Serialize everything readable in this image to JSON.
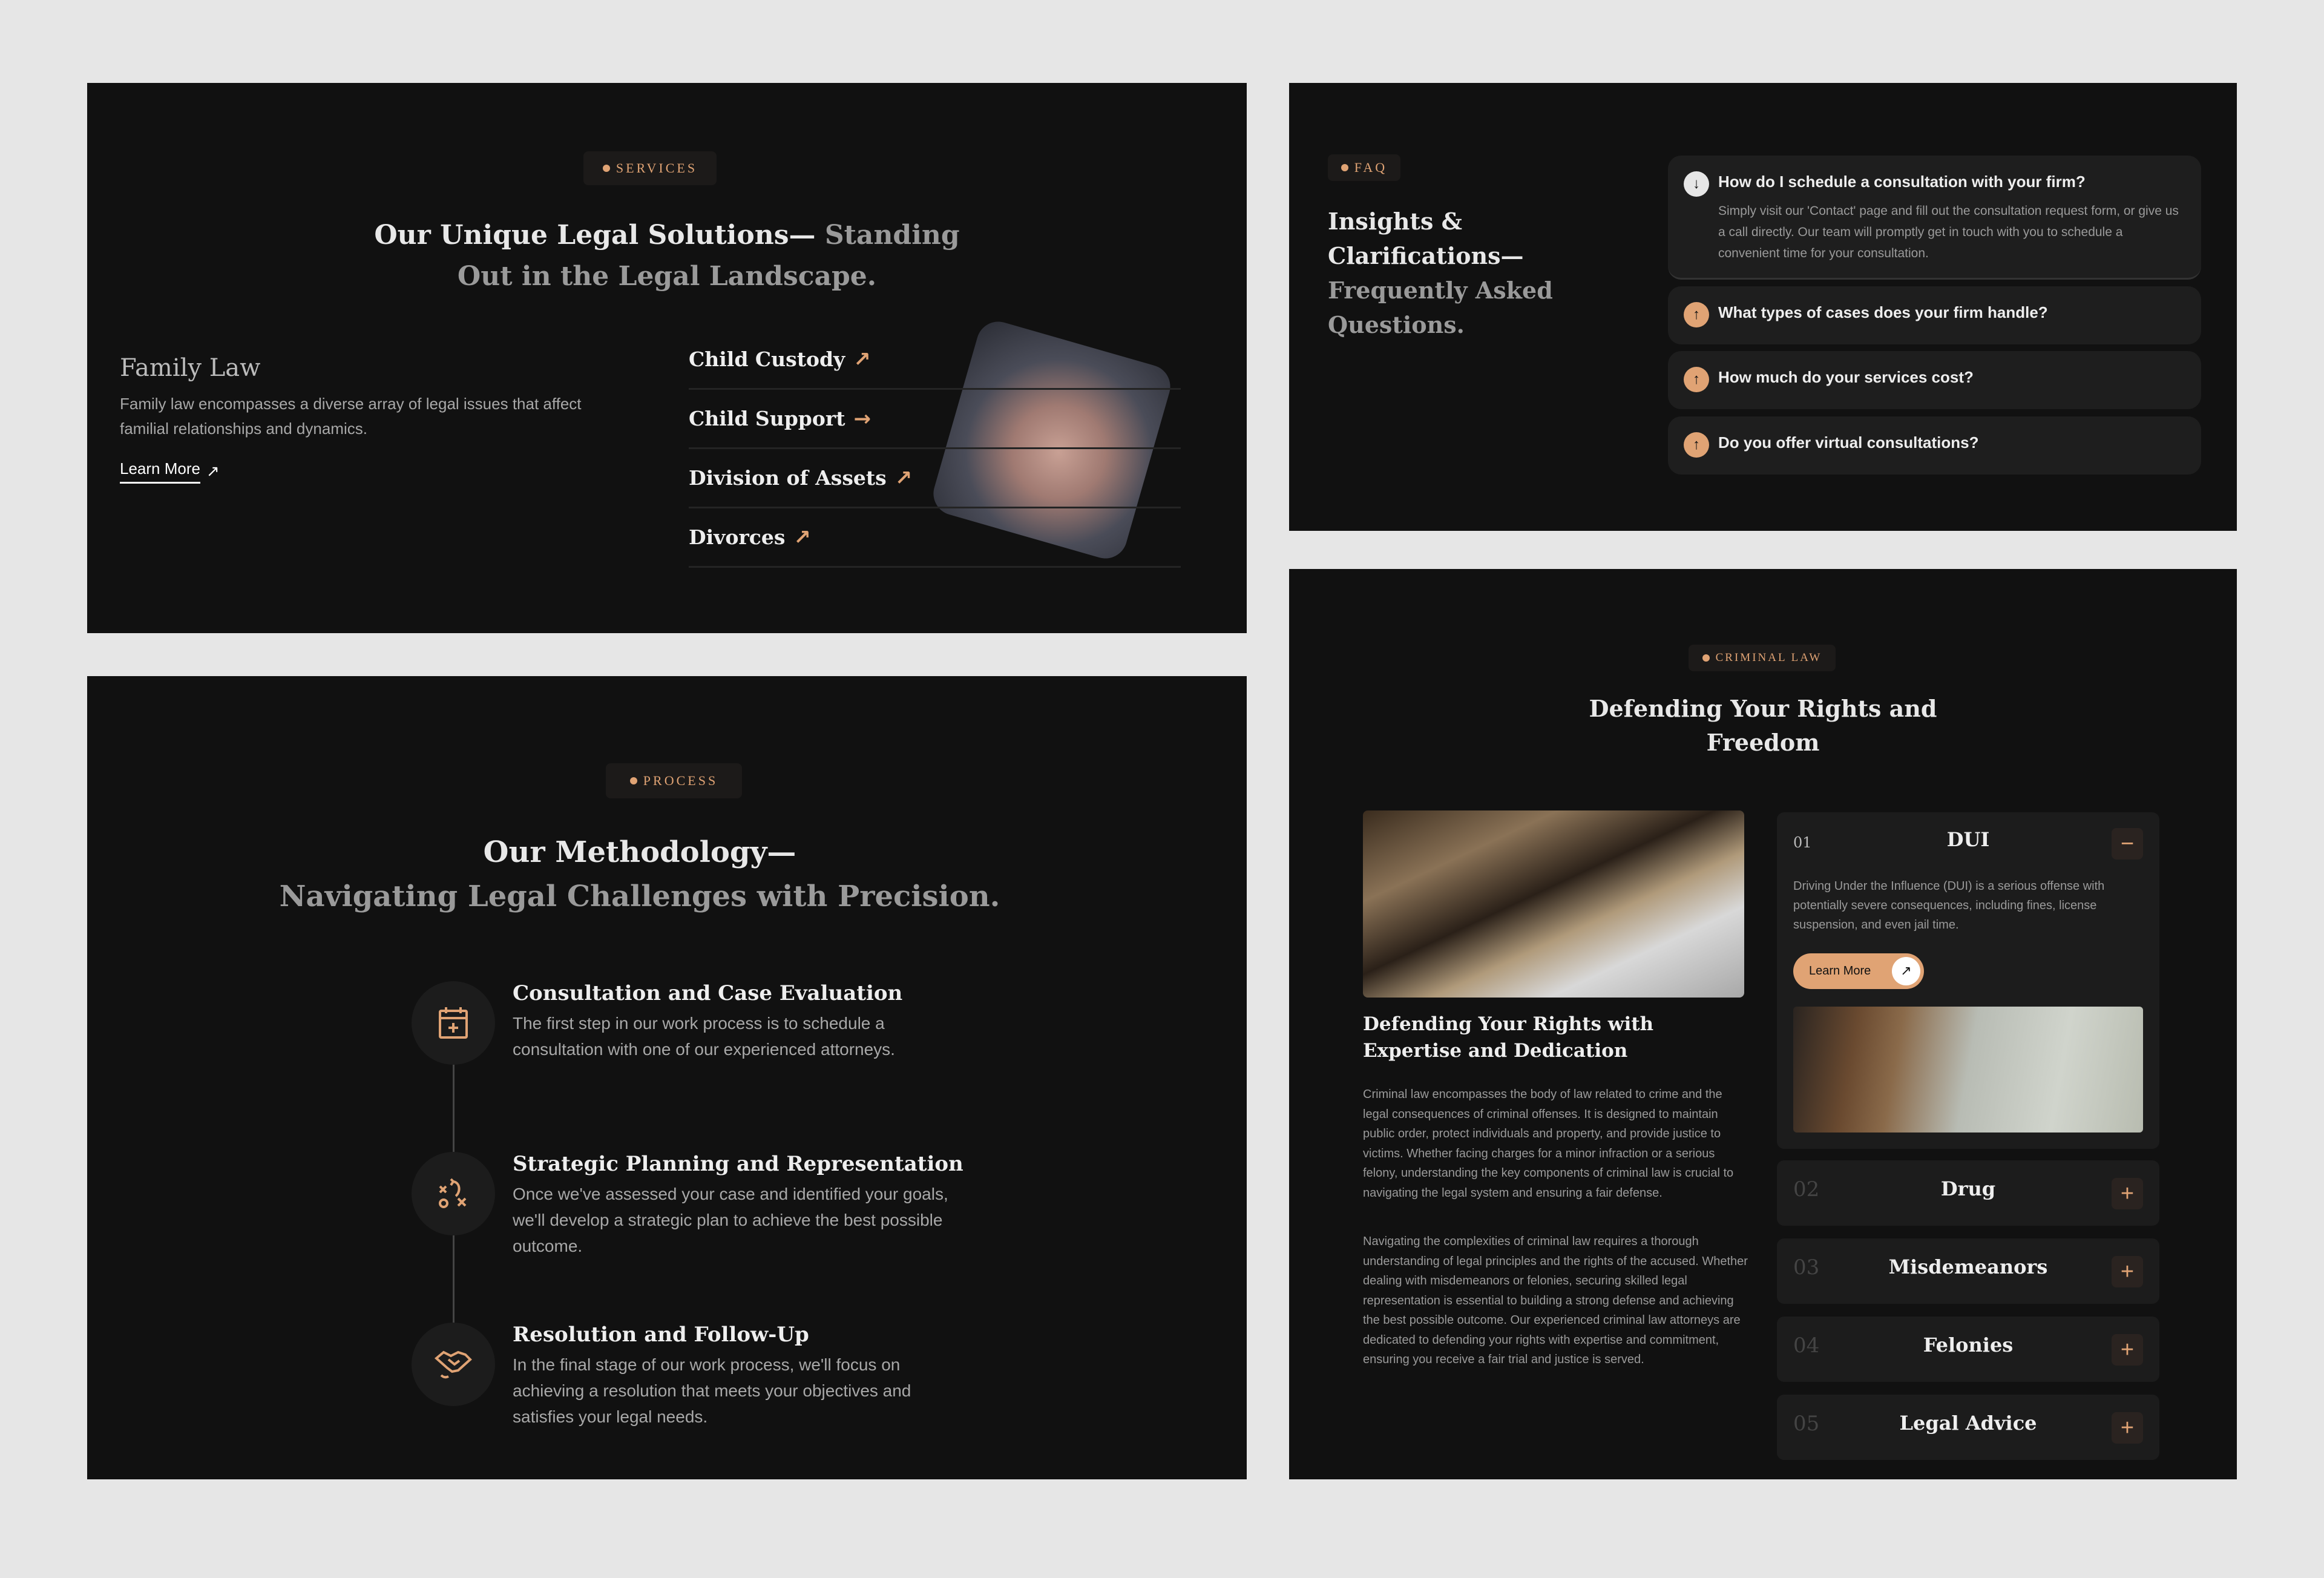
{
  "accent": "#e0a374",
  "services": {
    "badge": "SERVICES",
    "title_part1": "Our Unique Legal Solutions—",
    "title_part2": "Standing",
    "title_line2": "Out in the Legal Landscape.",
    "category_title": "Family Law",
    "category_desc": "Family law encompasses a diverse array of legal issues that affect familial relationships and dynamics.",
    "learn_more": "Learn More",
    "items": [
      {
        "label": "Child Custody",
        "icon": "arrow-up-right-icon",
        "glyph": "↗"
      },
      {
        "label": "Child Support",
        "icon": "arrow-right-icon",
        "glyph": "→"
      },
      {
        "label": "Division of Assets",
        "icon": "arrow-up-right-icon",
        "glyph": "↗"
      },
      {
        "label": "Divorces",
        "icon": "arrow-up-right-icon",
        "glyph": "↗"
      }
    ]
  },
  "faq": {
    "badge": "FAQ",
    "title_line1": "Insights &",
    "title_line2": "Clarifications—",
    "title_line3": "Frequently Asked",
    "title_line4": "Questions.",
    "items": [
      {
        "q": "How do I schedule a consultation with your firm?",
        "a": "Simply visit our 'Contact' page and fill out the consultation request form, or give us a call directly. Our team will promptly get in touch with you to schedule a convenient time for your consultation.",
        "expanded": true
      },
      {
        "q": "What types of cases does your firm handle?",
        "expanded": false
      },
      {
        "q": "How much do your services cost?",
        "expanded": false
      },
      {
        "q": "Do you offer virtual consultations?",
        "expanded": false
      }
    ]
  },
  "process": {
    "badge": "PROCESS",
    "title_line1": "Our Methodology—",
    "title_line2": "Navigating Legal Challenges with Precision.",
    "steps": [
      {
        "title": "Consultation and Case Evaluation",
        "desc": "The first step in our work process is to schedule a consultation with one of our experienced attorneys.",
        "icon": "calendar-plus-icon"
      },
      {
        "title": "Strategic Planning and Representation",
        "desc": "Once we've assessed your case and identified your goals, we'll develop a strategic plan to achieve the best possible outcome.",
        "icon": "strategy-icon"
      },
      {
        "title": "Resolution and Follow-Up",
        "desc": "In the final stage of our work process, we'll focus on achieving a resolution that meets your objectives and satisfies your legal needs.",
        "icon": "handshake-icon"
      }
    ]
  },
  "criminal": {
    "badge": "CRIMINAL LAW",
    "title_line1": "Defending Your Rights and",
    "title_line2": "Freedom",
    "heading": "Defending Your Rights with Expertise and Dedication",
    "para1": "Criminal law encompasses the body of law related to crime and the legal consequences of criminal offenses. It is designed to maintain public order, protect individuals and property, and provide justice to victims. Whether facing charges for a minor infraction or a serious felony, understanding the key components of criminal law is crucial to navigating the legal system and ensuring a fair defense.",
    "para2": "Navigating the complexities of criminal law requires a thorough understanding of legal principles and the rights of the accused. Whether dealing with misdemeanors or felonies, securing skilled legal representation is essential to building a strong defense and achieving the best possible outcome. Our experienced criminal law attorneys are dedicated to defending your rights with expertise and commitment, ensuring you receive a fair trial and justice is served.",
    "active": {
      "num": "01",
      "name": "DUI",
      "desc": "Driving Under the Influence (DUI) is a serious offense with potentially severe consequences, including fines, license suspension, and even jail time.",
      "learn_more": "Learn More"
    },
    "items": [
      {
        "num": "02",
        "name": "Drug"
      },
      {
        "num": "03",
        "name": "Misdemeanors"
      },
      {
        "num": "04",
        "name": "Felonies"
      },
      {
        "num": "05",
        "name": "Legal Advice"
      }
    ]
  }
}
